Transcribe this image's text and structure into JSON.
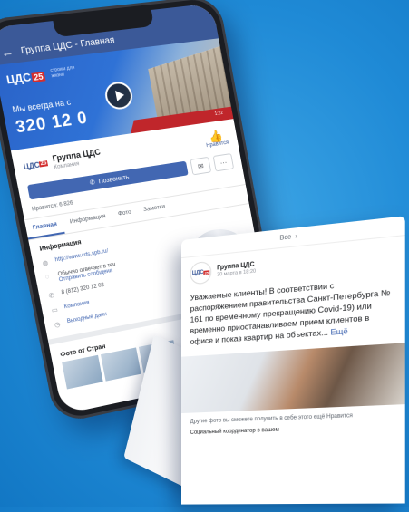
{
  "phone": {
    "header_title": "Группа ЦДС - Главная",
    "cover": {
      "logo": "ЦДС",
      "logo_badge": "25",
      "tagline": "строим для жизни",
      "slogan": "Мы всегда на с",
      "phone": "320 12 0",
      "badge": "1:22"
    },
    "page": {
      "logo": "ЦДС",
      "logo_badge": "25",
      "name": "Группа ЦДС",
      "category": "Компания",
      "like_label": "Нравится"
    },
    "actions": {
      "call_label": "Позвонить",
      "message_icon": "messenger-icon",
      "more_icon": "more-icon"
    },
    "likes_count": "Нравится: 6 826",
    "tabs": [
      "Главная",
      "Информация",
      "Фото",
      "Заметки"
    ],
    "info": {
      "title": "Информация",
      "website": "http://www.cds.spb.ru/",
      "response": "Обычно отвечает в теч",
      "send_message": "Отправить сообщени",
      "phone": "8 (812) 320 12 02",
      "type": "Компания",
      "hours": "Выходные данн"
    },
    "photos_title": "Фото от Стран"
  },
  "ribbon": {
    "top_label": "Все",
    "post": {
      "avatar_logo": "ЦДС",
      "avatar_badge": "25",
      "name": "Группа ЦДС",
      "date": "30 марта в 18:20",
      "text": "Уважаемые клиенты! В соответствии с распоряжением правительства Санкт-Петербурга № 161 по временному прекращению Covid-19) или временно приостанавливаем прием клиентов в офисе и показ квартир на объектах...",
      "more": "Ещё",
      "footer": "Другие фото вы сможете получить в себе этого ещё Нравится",
      "footer2": "Социальный координатор в вашем"
    }
  },
  "colors": {
    "background": "#1f8ad6",
    "facebook_blue": "#3b5998",
    "brand_red": "#d32f2f"
  }
}
